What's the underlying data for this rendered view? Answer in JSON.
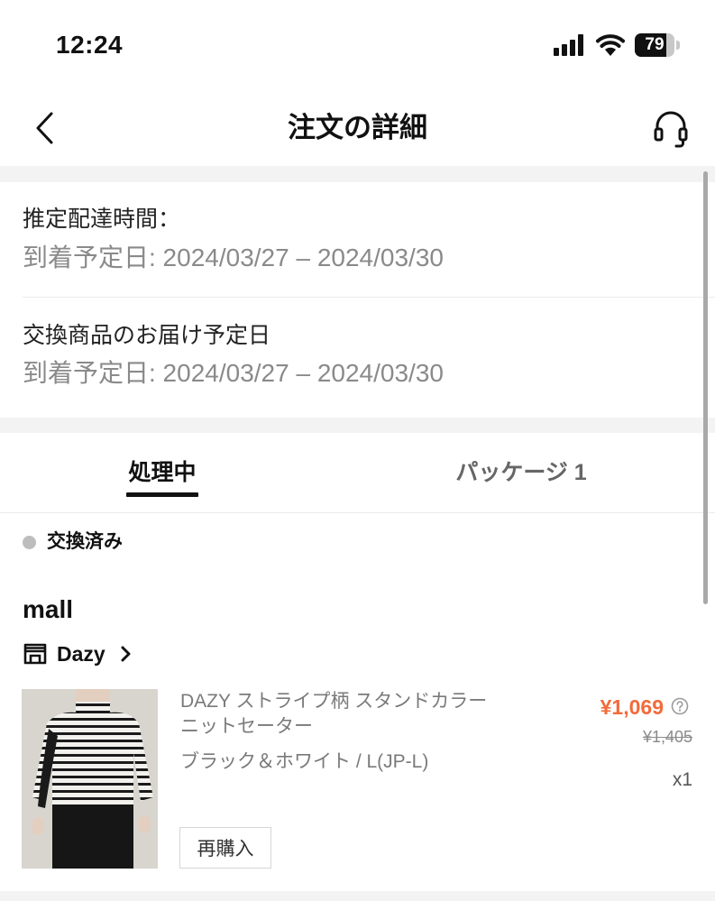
{
  "status_bar": {
    "time": "12:24",
    "battery": "79",
    "battery_level": 0.79
  },
  "nav": {
    "title": "注文の詳細",
    "back_icon": "chevron-left-icon",
    "support_icon": "headset-icon"
  },
  "delivery": [
    {
      "label": "推定配達時間：",
      "value": "到着予定日:  2024/03/27 – 2024/03/30"
    },
    {
      "label": "交換商品のお届け予定日",
      "value": "到着予定日:  2024/03/27 – 2024/03/30"
    }
  ],
  "tabs": [
    {
      "label": "処理中",
      "active": true
    },
    {
      "label": "パッケージ 1",
      "active": false
    }
  ],
  "order_status": "交換済み",
  "mall": "mall",
  "store": {
    "name": "Dazy",
    "icon": "store-icon"
  },
  "product": {
    "title": "DAZY ストライプ柄 スタンドカラー ニットセーター",
    "variant": "ブラック＆ホワイト / L(JP-L)",
    "price": "¥1,069",
    "original_price": "¥1,405",
    "quantity": "x1",
    "rebuy_label": "再購入"
  },
  "colors": {
    "accent_price": "#f26b3a",
    "background": "#ffffff",
    "divider": "#f3f3f3"
  }
}
